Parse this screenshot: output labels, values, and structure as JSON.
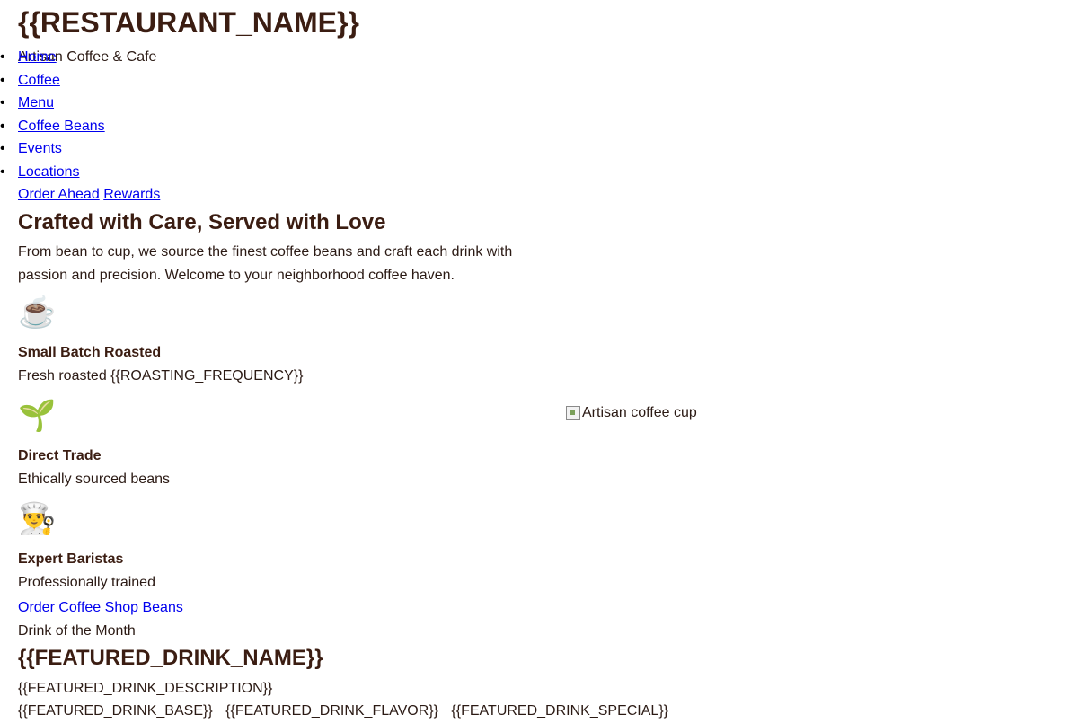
{
  "header": {
    "brand": "{{RESTAURANT_NAME}}",
    "tagline": "Artisan Coffee & Cafe"
  },
  "nav": {
    "items": [
      "Home",
      "Coffee",
      "Menu",
      "Coffee Beans",
      "Events",
      "Locations"
    ],
    "actions": [
      "Order Ahead",
      "Rewards"
    ]
  },
  "hero": {
    "title": "Crafted with Care, Served with Love",
    "description": "From bean to cup, we source the finest coffee beans and craft each drink with passion and precision. Welcome to your neighborhood coffee haven.",
    "features": [
      {
        "icon": "☕",
        "icon_name": "coffee-cup-icon",
        "title": "Small Batch Roasted",
        "desc": "Fresh roasted {{ROASTING_FREQUENCY}}"
      },
      {
        "icon": "🌱",
        "icon_name": "seedling-icon",
        "title": "Direct Trade",
        "desc": "Ethically sourced beans"
      },
      {
        "icon": "👨‍🍳",
        "icon_name": "chef-icon",
        "title": "Expert Baristas",
        "desc": "Professionally trained"
      }
    ],
    "image_alt": "Artisan coffee cup",
    "cta": [
      "Order Coffee",
      "Shop Beans"
    ]
  },
  "featured": {
    "eyebrow": "Drink of the Month",
    "name": "{{FEATURED_DRINK_NAME}}",
    "description": "{{FEATURED_DRINK_DESCRIPTION}}",
    "tags": [
      "{{FEATURED_DRINK_BASE}}",
      "{{FEATURED_DRINK_FLAVOR}}",
      "{{FEATURED_DRINK_SPECIAL}}"
    ]
  },
  "colors": {
    "heading": "#3b1d12",
    "text": "#2b1a14",
    "link": "#0000ee"
  }
}
